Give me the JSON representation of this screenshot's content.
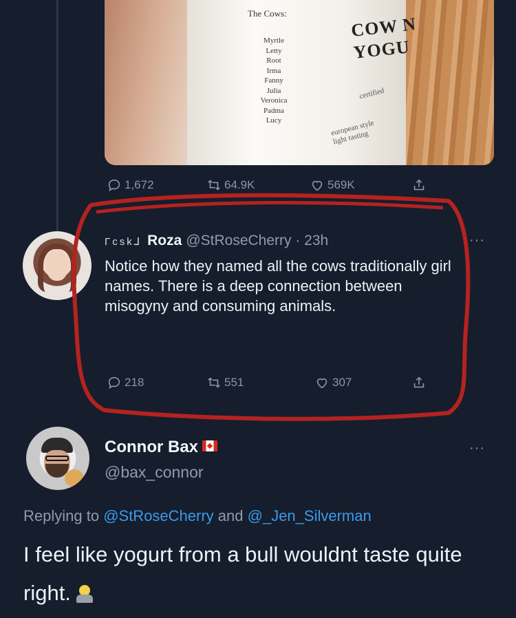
{
  "image_post": {
    "jar_heading": "The Cows:",
    "cow_names": [
      "Myrtle",
      "Letty",
      "Root",
      "Irma",
      "Fanny",
      "Julia",
      "Veronica",
      "Padma",
      "Lucy"
    ],
    "brand_line1": "COW N",
    "brand_line2": "YOGU",
    "certified": "certified",
    "european": "european style",
    "light": "light tasting",
    "replies": "1,672",
    "retweets": "64.9K",
    "likes": "569K"
  },
  "quoted_tweet": {
    "flair": "Γcsk⅃",
    "name": "Roza",
    "handle_time": "@StRoseCherry · 23h",
    "more": "···",
    "text": "Notice how they named all the cows traditionally girl names. There is a deep connection between misogyny and consuming animals.",
    "replies": "218",
    "retweets": "551",
    "likes": "307"
  },
  "reply_tweet": {
    "name": "Connor Bax",
    "handle": "@bax_connor",
    "more": "···",
    "replying_prefix": "Replying to ",
    "reply_user_1": "@StRoseCherry",
    "reply_and": " and ",
    "reply_user_2": "@_Jen_Silverman",
    "text": "I feel like yogurt from a bull wouldnt taste quite right."
  },
  "colors": {
    "background": "#161d2c",
    "link": "#3b9aea",
    "annotation_circle": "#b4231f"
  }
}
